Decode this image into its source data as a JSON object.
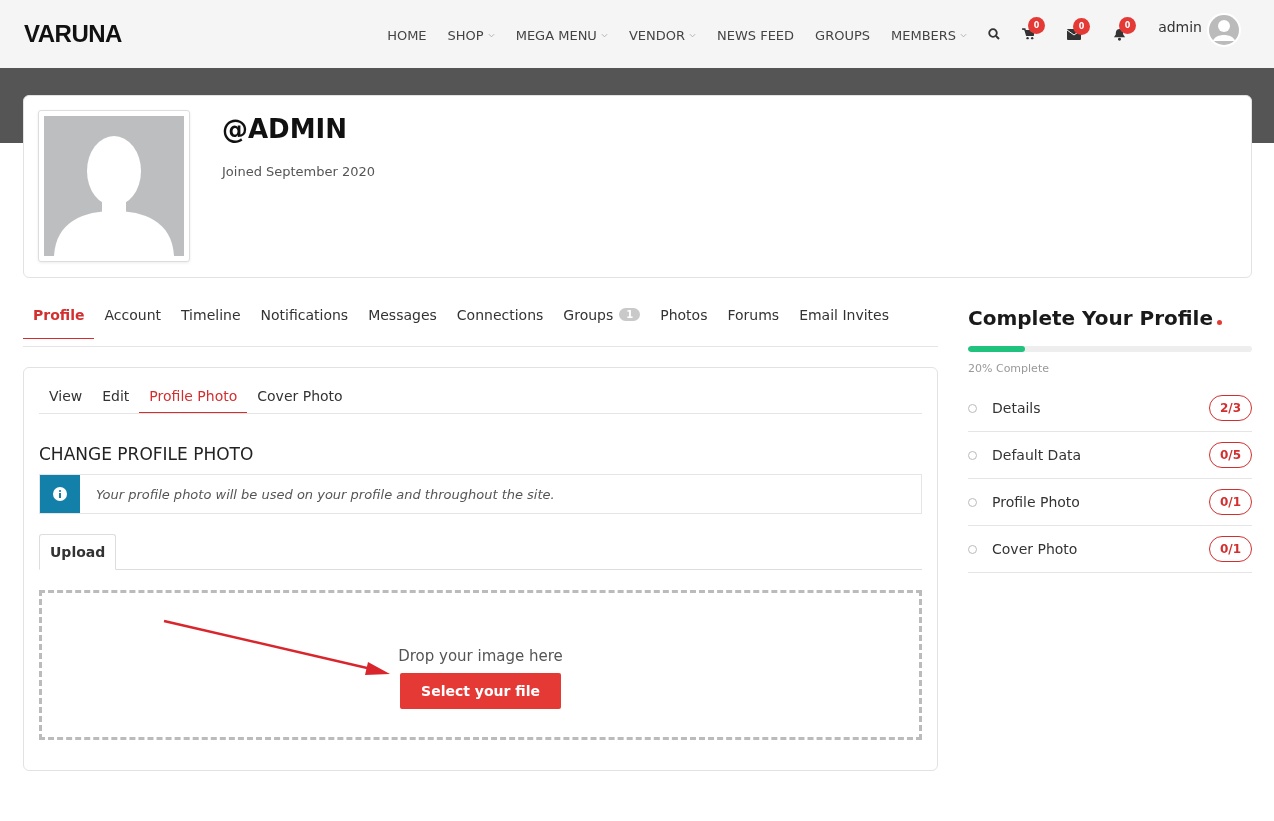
{
  "logo": {
    "text": "VARUNA"
  },
  "nav": [
    {
      "label": "HOME",
      "dropdown": false
    },
    {
      "label": "SHOP",
      "dropdown": true
    },
    {
      "label": "MEGA MENU",
      "dropdown": true
    },
    {
      "label": "VENDOR",
      "dropdown": true
    },
    {
      "label": "NEWS FEED",
      "dropdown": false
    },
    {
      "label": "GROUPS",
      "dropdown": false
    },
    {
      "label": "MEMBERS",
      "dropdown": true
    }
  ],
  "header_icons": [
    {
      "kind": "cart",
      "badge": "0"
    },
    {
      "kind": "mail",
      "badge": "0"
    },
    {
      "kind": "bell",
      "badge": "0"
    }
  ],
  "user": {
    "name": "admin"
  },
  "profile": {
    "handle": "@ADMIN",
    "joined": "Joined September 2020"
  },
  "tabs": [
    {
      "label": "Profile",
      "selected": true
    },
    {
      "label": "Account",
      "selected": false
    },
    {
      "label": "Timeline",
      "selected": false
    },
    {
      "label": "Notifications",
      "selected": false
    },
    {
      "label": "Messages",
      "selected": false
    },
    {
      "label": "Connections",
      "selected": false
    },
    {
      "label": "Groups",
      "selected": false,
      "count": "1"
    },
    {
      "label": "Photos",
      "selected": false
    },
    {
      "label": "Forums",
      "selected": false
    },
    {
      "label": "Email Invites",
      "selected": false
    }
  ],
  "subtabs": [
    {
      "label": "View",
      "selected": false
    },
    {
      "label": "Edit",
      "selected": false
    },
    {
      "label": "Profile Photo",
      "selected": true
    },
    {
      "label": "Cover Photo",
      "selected": false
    }
  ],
  "section_title": "CHANGE PROFILE PHOTO",
  "info": "Your profile photo will be used on your profile and throughout the site.",
  "upload_tabs": [
    {
      "label": "Upload",
      "selected": true
    }
  ],
  "dropzone": {
    "text": "Drop your image here",
    "button": "Select your file"
  },
  "completion": {
    "title": "Complete Your Profile",
    "level": 0.2,
    "reading": "20% Complete",
    "items": [
      {
        "label": "Details",
        "count": "2/3"
      },
      {
        "label": "Default Data",
        "count": "0/5"
      },
      {
        "label": "Profile Photo",
        "count": "0/1"
      },
      {
        "label": "Cover Photo",
        "count": "0/1"
      }
    ]
  }
}
